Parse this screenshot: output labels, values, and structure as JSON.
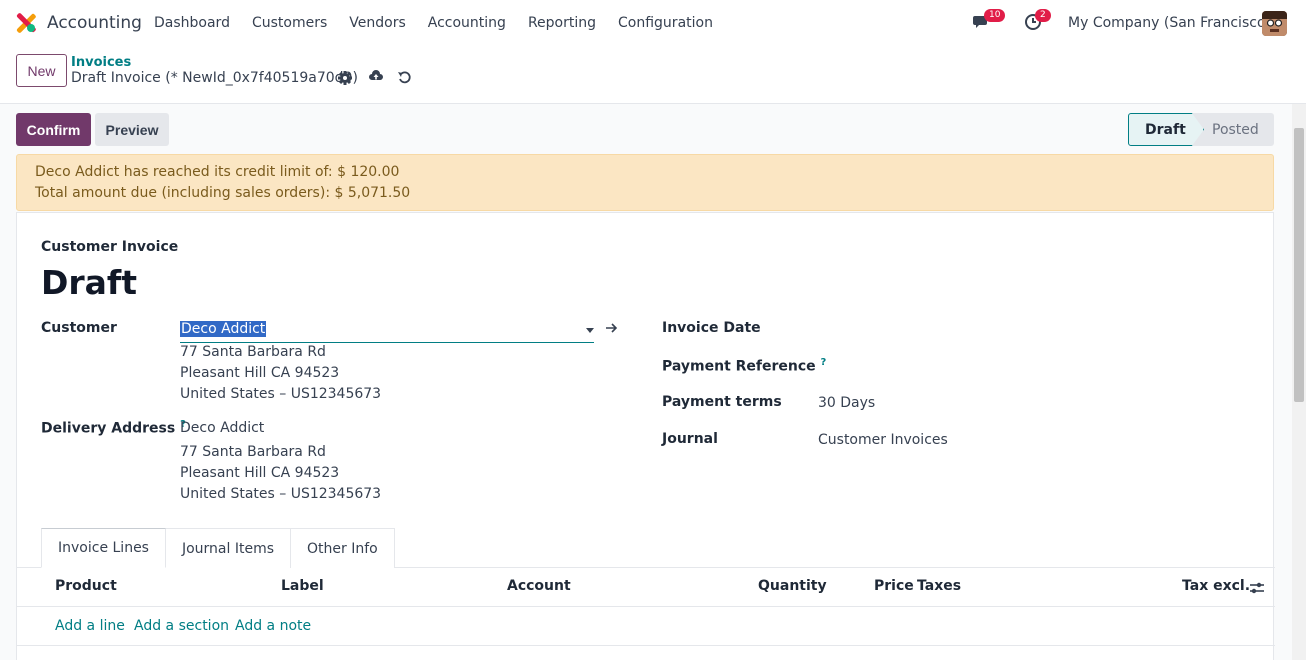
{
  "app": {
    "name": "Accounting"
  },
  "menu": [
    "Dashboard",
    "Customers",
    "Vendors",
    "Accounting",
    "Reporting",
    "Configuration"
  ],
  "systray": {
    "messages_count": "10",
    "activities_count": "2",
    "company": "My Company (San Francisco)"
  },
  "control_panel": {
    "new_label": "New",
    "breadcrumb_parent": "Invoices",
    "breadcrumb_current": "Draft Invoice (* NewId_0x7f40519a70d0)"
  },
  "actions": {
    "confirm_label": "Confirm",
    "preview_label": "Preview"
  },
  "statusbar": {
    "stages": [
      "Draft",
      "Posted"
    ],
    "current": "Draft"
  },
  "alert": {
    "line1": "Deco Addict has reached its credit limit of: $ 120.00",
    "line2": "Total amount due (including sales orders): $ 5,071.50"
  },
  "invoice": {
    "type_label": "Customer Invoice",
    "state": "Draft",
    "customer_label": "Customer",
    "customer_value": "Deco Addict",
    "customer_address": [
      "77 Santa Barbara Rd",
      "Pleasant Hill CA 94523",
      "United States – US12345673"
    ],
    "delivery_label": "Delivery Address",
    "delivery_name": "Deco Addict",
    "delivery_address": [
      "77 Santa Barbara Rd",
      "Pleasant Hill CA 94523",
      "United States – US12345673"
    ],
    "invoice_date_label": "Invoice Date",
    "payment_ref_label": "Payment Reference",
    "payment_terms_label": "Payment terms",
    "payment_terms_value": "30 Days",
    "journal_label": "Journal",
    "journal_value": "Customer Invoices",
    "help_mark": "?"
  },
  "tabs": [
    "Invoice Lines",
    "Journal Items",
    "Other Info"
  ],
  "lines_table": {
    "columns": [
      "Product",
      "Label",
      "Account",
      "Quantity",
      "Price",
      "Taxes",
      "Tax excl."
    ],
    "add_line": "Add a line",
    "add_section": "Add a section",
    "add_note": "Add a note"
  },
  "colors": {
    "brand": "#71396a",
    "accent": "#017e84",
    "alert_bg": "#fbe6c3"
  }
}
